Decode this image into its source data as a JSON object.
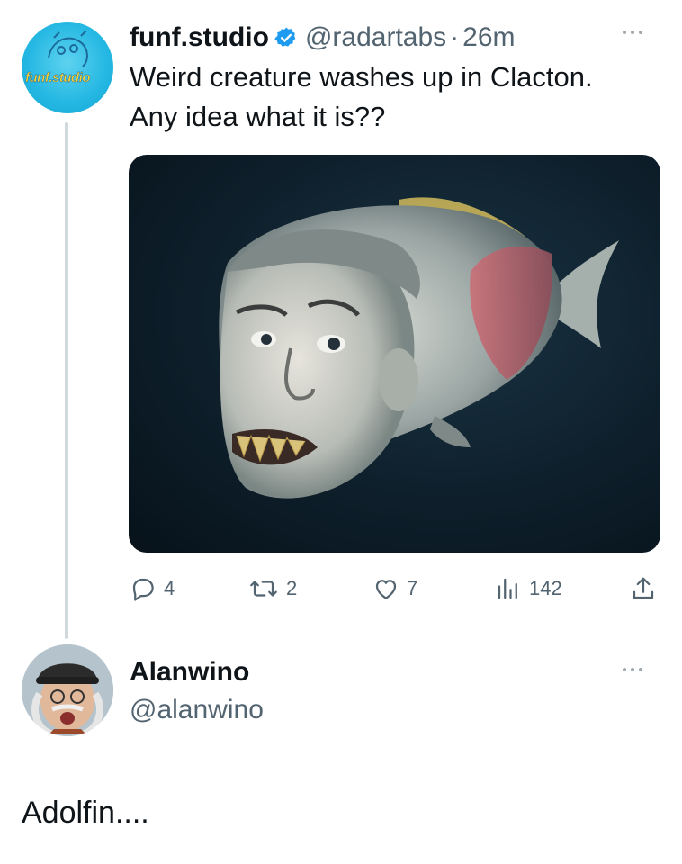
{
  "tweet": {
    "display_name": "funf.studio",
    "handle": "@radartabs",
    "separator": "·",
    "time": "26m",
    "text_line1": "Weird creature washes up in Clacton.",
    "text_line2": "Any idea what it is??",
    "avatar_text": "funf.studio",
    "verified_icon": "verified-badge-icon",
    "verified_color": "#1d9bf0"
  },
  "actions": {
    "replies": "4",
    "retweets": "2",
    "likes": "7",
    "views": "142"
  },
  "reply": {
    "display_name": "Alanwino",
    "handle": "@alanwino",
    "text": "Adolfin...."
  },
  "colors": {
    "secondary_text": "#536471",
    "thread_line": "#cfd9de",
    "avatar_bg": "#23b7e2"
  }
}
